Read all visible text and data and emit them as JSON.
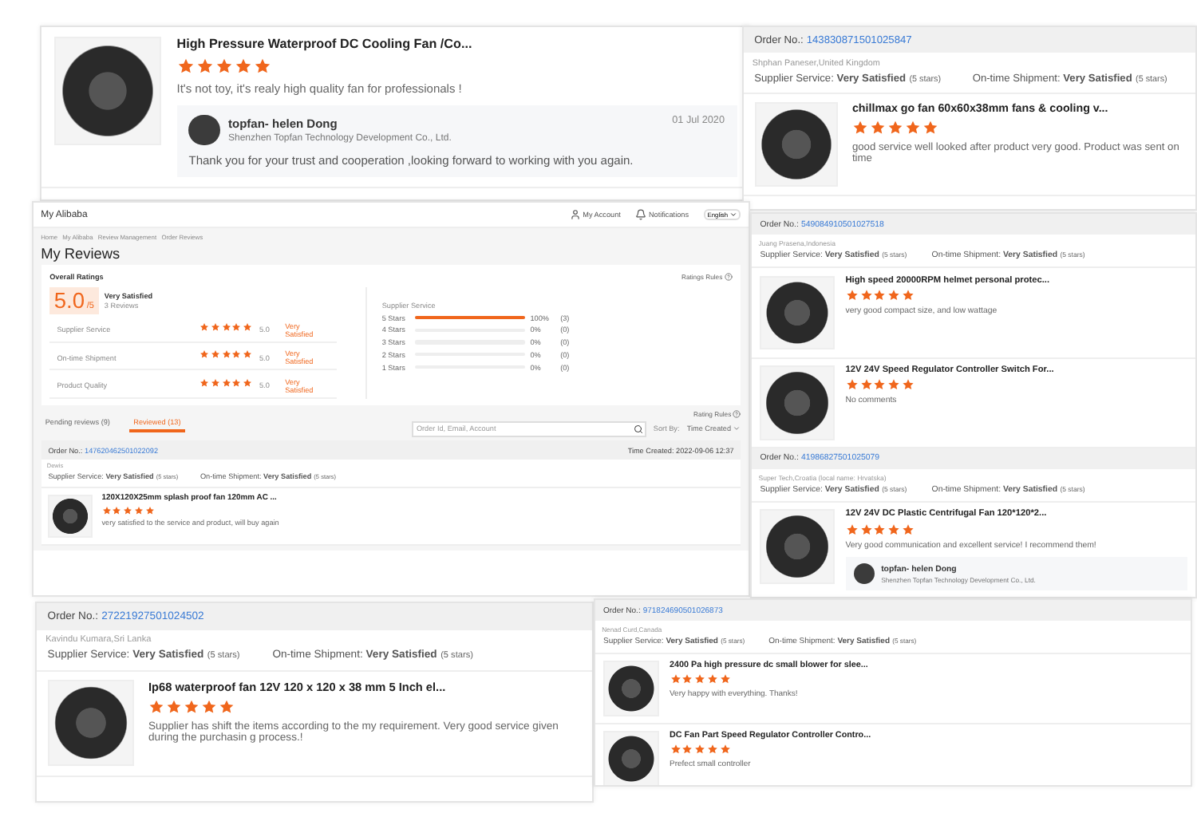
{
  "top_review": {
    "item": {
      "title": "High Pressure Waterproof DC Cooling Fan /Co...",
      "stars": 5,
      "comment": "It's not toy, it's realy high quality fan for professionals !",
      "reply": {
        "name": "topfan- helen Dong",
        "company": "Shenzhen Topfan Technology Development Co., Ltd.",
        "date": "01 Jul 2020",
        "text": "Thank you for your trust and cooperation ,looking forward to working with you again."
      }
    }
  },
  "orders_top_right": [
    {
      "label": "Order No.:",
      "number": "143830871501025847",
      "buyer": "Shphan Paneser,United Kingdom",
      "ratings": [
        {
          "label": "Supplier Service:",
          "value": "Very Satisfied",
          "note": "(5 stars)"
        },
        {
          "label": "On-time Shipment:",
          "value": "Very Satisfied",
          "note": "(5 stars)"
        }
      ],
      "items": [
        {
          "title": "chillmax go fan 60x60x38mm fans & cooling v...",
          "stars": 5,
          "comment": "good service well looked after product very good. Product was sent on time"
        }
      ]
    }
  ],
  "alibaba_page": {
    "brand": "My Alibaba",
    "account": "My Account",
    "notifications": "Notifications",
    "language": "English",
    "breadcrumb": [
      "Home",
      "My Alibaba",
      "Review Management",
      "Order Reviews"
    ],
    "title": "My Reviews",
    "ratings_rules": "Ratings Rules",
    "overall_title": "Overall Ratings",
    "score": "5.0",
    "score_max": "/5",
    "score_label": "Very Satisfied",
    "review_count": "3 Reviews",
    "categories": [
      {
        "label": "Supplier Service",
        "stars": 5,
        "score": "5.0",
        "verdict": "Very Satisfied"
      },
      {
        "label": "On-time Shipment",
        "stars": 5,
        "score": "5.0",
        "verdict": "Very Satisfied"
      },
      {
        "label": "Product Quality",
        "stars": 5,
        "score": "5.0",
        "verdict": "Very Satisfied"
      }
    ],
    "histogram_title": "Supplier Service",
    "histogram": [
      {
        "label": "5 Stars",
        "level": 1,
        "percent": "100%",
        "count": "(3)"
      },
      {
        "label": "4 Stars",
        "level": 0,
        "percent": "0%",
        "count": "(0)"
      },
      {
        "label": "3 Stars",
        "level": 0,
        "percent": "0%",
        "count": "(0)"
      },
      {
        "label": "2 Stars",
        "level": 0,
        "percent": "0%",
        "count": "(0)"
      },
      {
        "label": "1 Stars",
        "level": 0,
        "percent": "0%",
        "count": "(0)"
      }
    ],
    "rating_rules": "Rating Rules",
    "tabs": [
      {
        "label": "Pending reviews (9)",
        "selected": false
      },
      {
        "label": "Reviewed (13)",
        "selected": true
      }
    ],
    "search": {
      "placeholder": "Order Id, Email, Account"
    },
    "sort_label": "Sort By:",
    "sort_value": "Time Created",
    "order": {
      "label": "Order No.:",
      "number": "147620462501022092",
      "time": "Time Created: 2022-09-06 12:37",
      "buyer": "Dewis",
      "ratings": [
        {
          "label": "Supplier Service:",
          "value": "Very Satisfied",
          "note": "(5 stars)"
        },
        {
          "label": "On-time Shipment:",
          "value": "Very Satisfied",
          "note": "(5 stars)"
        }
      ],
      "items": [
        {
          "title": "120X120X25mm splash proof fan 120mm AC ...",
          "stars": 5,
          "comment": "very satisfied to the service and product, will buy again"
        }
      ]
    }
  },
  "orders_right": [
    {
      "label": "Order No.:",
      "number": "549084910501027518",
      "buyer": "Juang Prasena,Indonesia",
      "ratings": [
        {
          "label": "Supplier Service:",
          "value": "Very Satisfied",
          "note": "(5 stars)"
        },
        {
          "label": "On-time Shipment:",
          "value": "Very Satisfied",
          "note": "(5 stars)"
        }
      ],
      "items": [
        {
          "title": "High speed 20000RPM helmet personal protec...",
          "stars": 5,
          "comment": "very good compact size, and low wattage"
        },
        {
          "title": "12V 24V Speed Regulator Controller Switch For...",
          "stars": 5,
          "comment": "No comments"
        }
      ]
    },
    {
      "label": "Order No.:",
      "number": "41986827501025079",
      "buyer": "Super Tech,Croatia (local name: Hrvatska)",
      "ratings": [
        {
          "label": "Supplier Service:",
          "value": "Very Satisfied",
          "note": "(5 stars)"
        },
        {
          "label": "On-time Shipment:",
          "value": "Very Satisfied",
          "note": "(5 stars)"
        }
      ],
      "items": [
        {
          "title": "12V 24V DC Plastic Centrifugal Fan 120*120*2...",
          "stars": 5,
          "comment": "Very good communication and excellent service! I recommend them!",
          "reply": {
            "name": "topfan- helen Dong",
            "company": "Shenzhen Topfan Technology Development Co., Ltd."
          }
        }
      ]
    }
  ],
  "orders_bottom_left": [
    {
      "label": "Order No.:",
      "number": "27221927501024502",
      "buyer": "Kavindu Kumara,Sri Lanka",
      "ratings": [
        {
          "label": "Supplier Service:",
          "value": "Very Satisfied",
          "note": "(5 stars)"
        },
        {
          "label": "On-time Shipment:",
          "value": "Very Satisfied",
          "note": "(5 stars)"
        }
      ],
      "items": [
        {
          "title": "Ip68 waterproof fan 12V 120 x 120 x 38 mm 5 Inch el...",
          "stars": 5,
          "comment": "Supplier has shift the items according to the my requirement. Very good service given during the purchasin g process.!"
        }
      ]
    }
  ],
  "orders_bottom_right": [
    {
      "label": "Order No.:",
      "number": "971824690501026873",
      "buyer": "Nenad Curd,Canada",
      "ratings": [
        {
          "label": "Supplier Service:",
          "value": "Very Satisfied",
          "note": "(5 stars)"
        },
        {
          "label": "On-time Shipment:",
          "value": "Very Satisfied",
          "note": "(5 stars)"
        }
      ],
      "items": [
        {
          "title": "2400 Pa high pressure dc small blower for slee...",
          "stars": 5,
          "comment": "Very happy with everything. Thanks!"
        },
        {
          "title": "DC Fan Part Speed Regulator Controller Contro...",
          "stars": 5,
          "comment": "Prefect small controller"
        }
      ]
    }
  ]
}
